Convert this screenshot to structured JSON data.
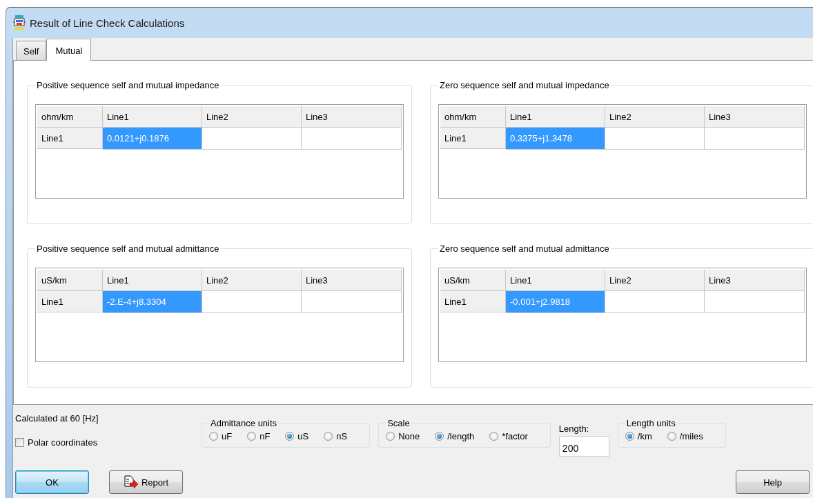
{
  "window": {
    "title": "Result of Line Check Calculations"
  },
  "tabs": [
    {
      "label": "Self",
      "selected": false
    },
    {
      "label": "Mutual",
      "selected": true
    }
  ],
  "groups": [
    {
      "title": "Positive sequence self and mutual impedance",
      "corner": "ohm/km",
      "columns": [
        "Line1",
        "Line2",
        "Line3"
      ],
      "rows": [
        {
          "label": "Line1",
          "cells": [
            {
              "value": "0.0121+j0.1876",
              "selected": true
            }
          ]
        }
      ]
    },
    {
      "title": "Zero sequence self and mutual impedance",
      "corner": "ohm/km",
      "columns": [
        "Line1",
        "Line2",
        "Line3"
      ],
      "rows": [
        {
          "label": "Line1",
          "cells": [
            {
              "value": "0.3375+j1.3478",
              "selected": true
            }
          ]
        }
      ]
    },
    {
      "title": "Positive sequence self and mutual admittance",
      "corner": "uS/km",
      "columns": [
        "Line1",
        "Line2",
        "Line3"
      ],
      "rows": [
        {
          "label": "Line1",
          "cells": [
            {
              "value": "-2.E-4+j8.3304",
              "selected": true
            }
          ]
        }
      ]
    },
    {
      "title": "Zero sequence self and mutual admittance",
      "corner": "uS/km",
      "columns": [
        "Line1",
        "Line2",
        "Line3"
      ],
      "rows": [
        {
          "label": "Line1",
          "cells": [
            {
              "value": "-0.001+j2.9818",
              "selected": true
            }
          ]
        }
      ]
    }
  ],
  "frequency_label": "Calculated at 60 [Hz]",
  "polar_coordinates": {
    "label": "Polar coordinates",
    "checked": false
  },
  "admittance_units": {
    "title": "Admittance units",
    "options": [
      {
        "label": "uF",
        "selected": false
      },
      {
        "label": "nF",
        "selected": false
      },
      {
        "label": "uS",
        "selected": true
      },
      {
        "label": "nS",
        "selected": false
      }
    ]
  },
  "scale": {
    "title": "Scale",
    "options": [
      {
        "label": "None",
        "selected": false
      },
      {
        "label": "/length",
        "selected": true
      },
      {
        "label": "*factor",
        "selected": false
      }
    ]
  },
  "length": {
    "label": "Length:",
    "value": "200"
  },
  "length_units": {
    "title": "Length units",
    "options": [
      {
        "label": "/km",
        "selected": true
      },
      {
        "label": "/miles",
        "selected": false
      }
    ]
  },
  "buttons": [
    {
      "label": "OK",
      "kind": "default"
    },
    {
      "label": "Report",
      "kind": "report"
    },
    {
      "label": "Help",
      "kind": "plain"
    }
  ]
}
